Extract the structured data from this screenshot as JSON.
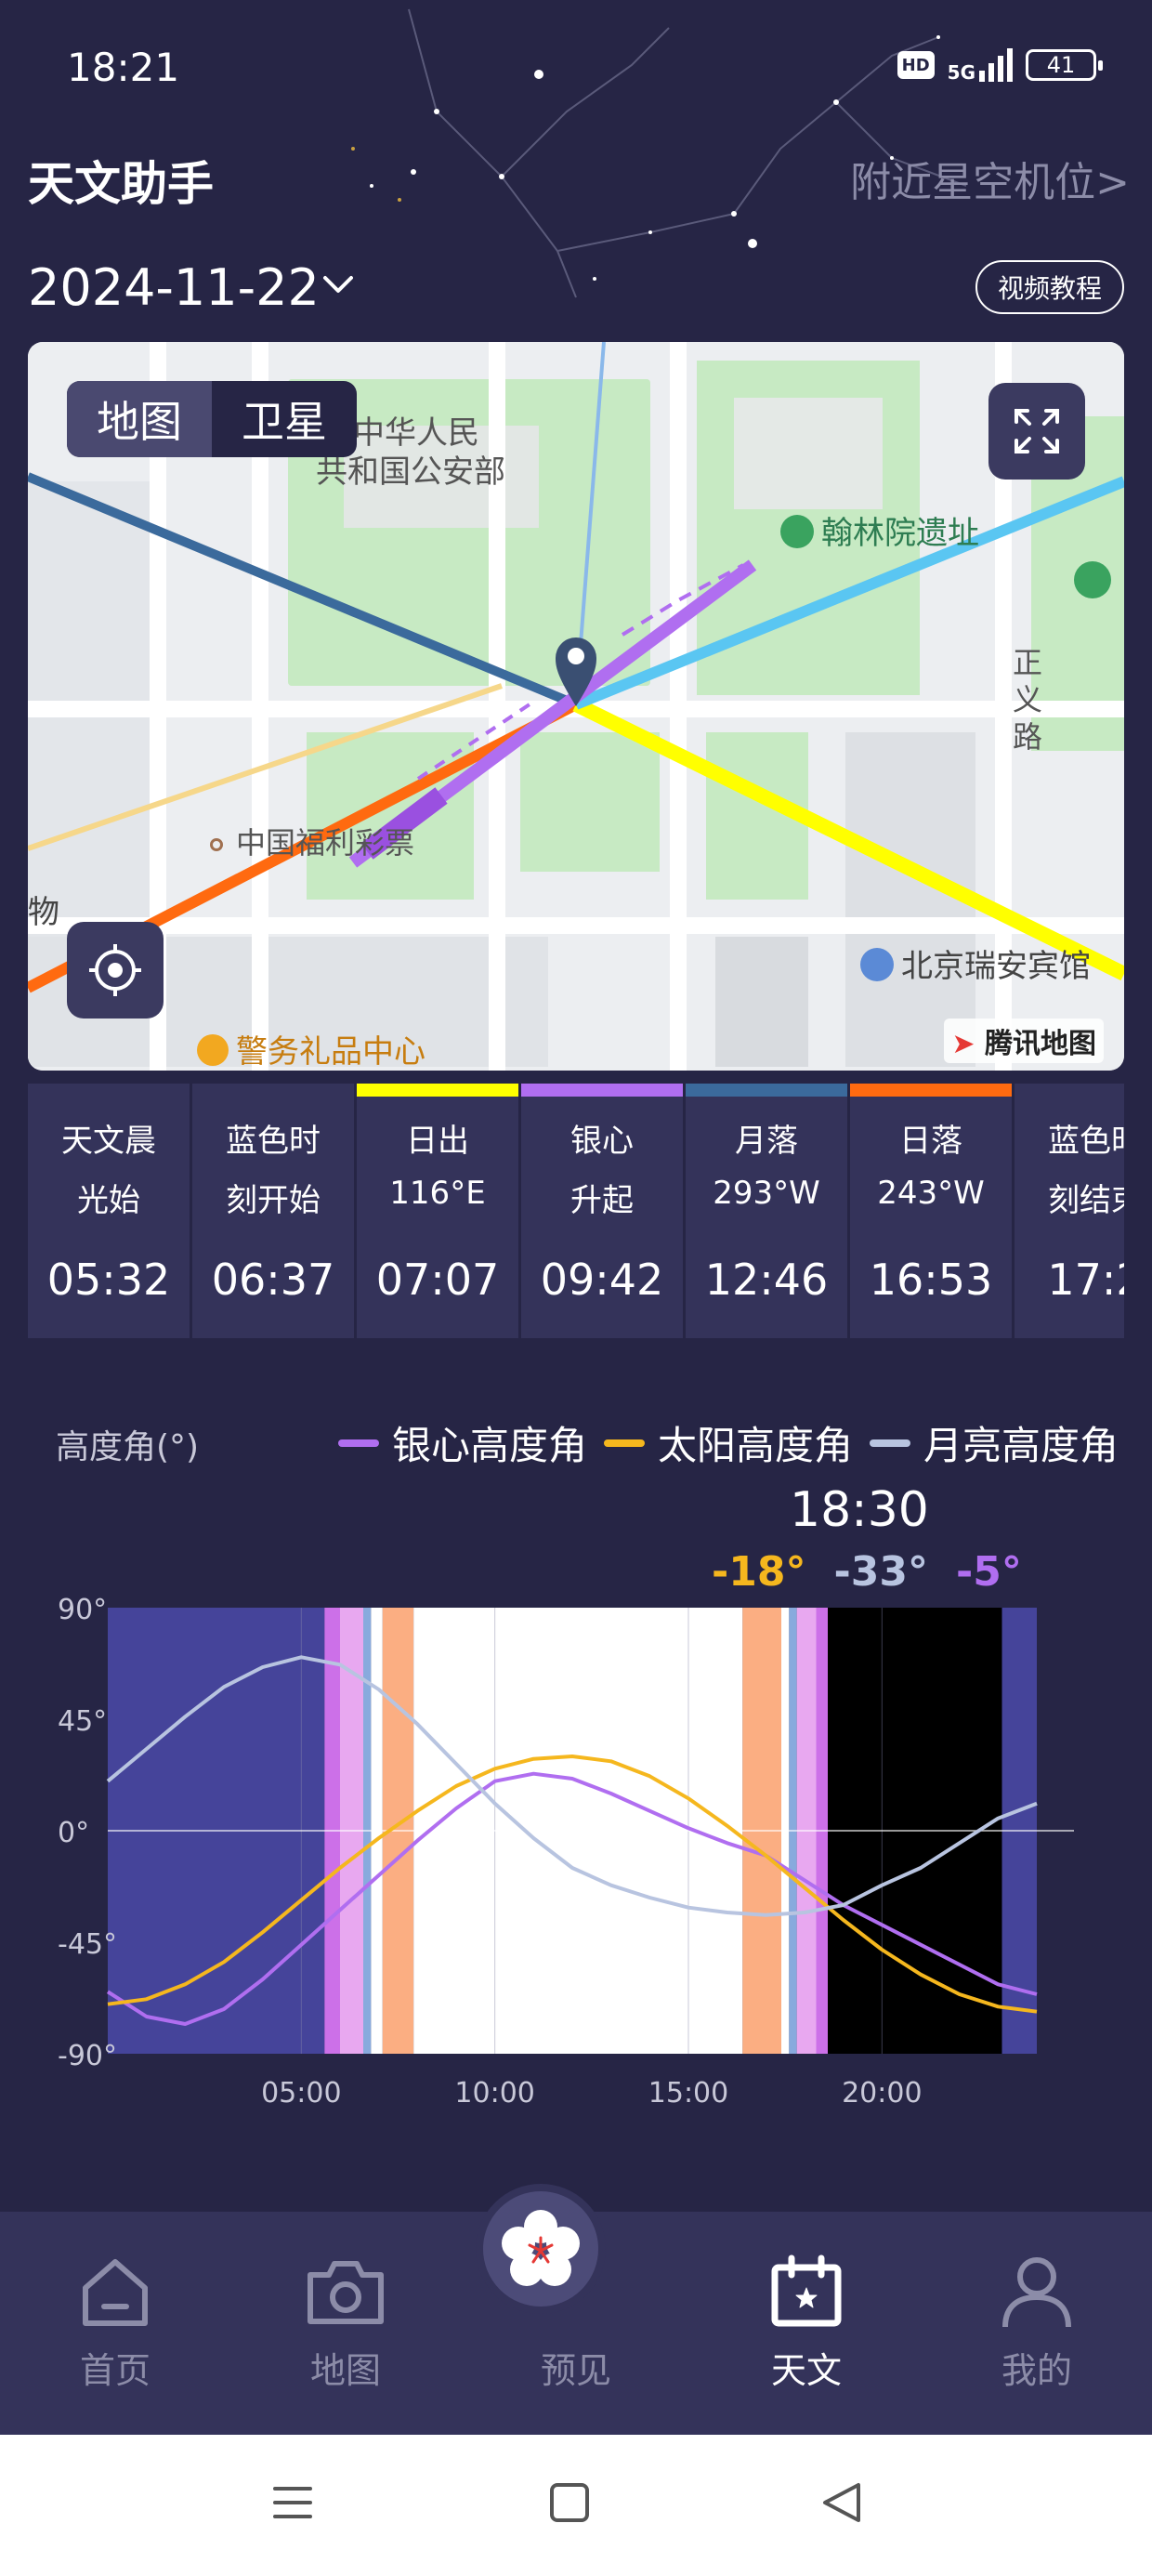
{
  "status_bar": {
    "time": "18:21",
    "hd": "HD",
    "network": "5G",
    "battery": "41"
  },
  "header": {
    "title": "天文助手",
    "nearby_link": "附近星空机位>",
    "date": "2024-11-22",
    "tutorial_button": "视频教程"
  },
  "map": {
    "toggle": {
      "map": "地图",
      "satellite": "卫星"
    },
    "labels": {
      "ministry_line1": "中华人民",
      "ministry_line2": "共和国公安部",
      "hanlin": "翰林院遗址",
      "lottery": "中国福利彩票",
      "zhengyi_1": "正",
      "zhengyi_2": "义",
      "zhengyi_3": "路",
      "hotel": "北京瑞安宾馆",
      "police_gift": "警务礼品中心",
      "edge": "物"
    },
    "brand": "腾讯地图"
  },
  "events": [
    {
      "line1": "天文晨",
      "line2": "光始",
      "time": "05:32",
      "color": ""
    },
    {
      "line1": "蓝色时",
      "line2": "刻开始",
      "time": "06:37",
      "color": ""
    },
    {
      "line1": "日出",
      "line2": "116°E",
      "time": "07:07",
      "color": "#ffff00"
    },
    {
      "line1": "银心",
      "line2": "升起",
      "time": "09:42",
      "color": "#b06ef0"
    },
    {
      "line1": "月落",
      "line2": "293°W",
      "time": "12:46",
      "color": "#3b6a9c"
    },
    {
      "line1": "日落",
      "line2": "243°W",
      "time": "16:53",
      "color": "#ff6a10"
    },
    {
      "line1": "蓝色时",
      "line2": "刻结束",
      "time": "17:2",
      "color": ""
    }
  ],
  "chart_data": {
    "type": "line",
    "ylabel": "高度角(°)",
    "ylim": [
      -90,
      90
    ],
    "yticks": [
      "90°",
      "45°",
      "0°",
      "-45°",
      "-90°"
    ],
    "xlim": [
      0,
      24
    ],
    "xticks": [
      {
        "label": "05:00",
        "value": 5
      },
      {
        "label": "10:00",
        "value": 10
      },
      {
        "label": "15:00",
        "value": 15
      },
      {
        "label": "20:00",
        "value": 20
      }
    ],
    "legend": [
      {
        "name": "银心高度角",
        "color": "#b06ef0"
      },
      {
        "name": "太阳高度角",
        "color": "#f5b71e"
      },
      {
        "name": "月亮高度角",
        "color": "#b8c4e0"
      }
    ],
    "series": [
      {
        "name": "银心高度角",
        "color": "#b06ef0",
        "x": [
          0,
          1,
          2,
          3,
          4,
          5,
          6,
          7,
          8,
          9,
          10,
          11,
          12,
          13,
          14,
          15,
          16,
          17,
          18,
          19,
          20,
          21,
          22,
          23,
          24
        ],
        "y": [
          -65,
          -75,
          -78,
          -72,
          -60,
          -46,
          -32,
          -18,
          -4,
          9,
          20,
          23,
          21,
          15,
          8,
          1,
          -5,
          -10,
          -20,
          -30,
          -38,
          -46,
          -54,
          -62,
          -66
        ]
      },
      {
        "name": "太阳高度角",
        "color": "#f5b71e",
        "x": [
          0,
          1,
          2,
          3,
          4,
          5,
          6,
          7,
          8,
          9,
          10,
          11,
          12,
          13,
          14,
          15,
          16,
          17,
          18,
          19,
          20,
          21,
          22,
          23,
          24
        ],
        "y": [
          -70,
          -68,
          -62,
          -53,
          -41,
          -28,
          -15,
          -3,
          8,
          18,
          25,
          29,
          30,
          28,
          22,
          13,
          2,
          -10,
          -23,
          -36,
          -48,
          -58,
          -66,
          -71,
          -73
        ]
      },
      {
        "name": "月亮高度角",
        "color": "#b8c4e0",
        "x": [
          0,
          1,
          2,
          3,
          4,
          5,
          6,
          7,
          8,
          9,
          10,
          11,
          12,
          13,
          14,
          15,
          16,
          17,
          18,
          19,
          20,
          21,
          22,
          23,
          24
        ],
        "y": [
          20,
          33,
          46,
          58,
          66,
          70,
          67,
          57,
          43,
          27,
          11,
          -3,
          -15,
          -22,
          -27,
          -31,
          -33,
          -34,
          -33,
          -30,
          -22,
          -15,
          -5,
          5,
          11
        ]
      }
    ],
    "bands": [
      {
        "from": 0,
        "to": 5.6,
        "color": "#45449a"
      },
      {
        "from": 5.6,
        "to": 6.0,
        "color": "#cc70e8"
      },
      {
        "from": 6.0,
        "to": 6.6,
        "color": "#e8a8f0"
      },
      {
        "from": 6.6,
        "to": 6.8,
        "color": "#88aadd"
      },
      {
        "from": 6.8,
        "to": 7.1,
        "color": "#ffffff"
      },
      {
        "from": 7.1,
        "to": 7.9,
        "color": "#fbae82"
      },
      {
        "from": 7.9,
        "to": 16.4,
        "color": "#ffffff"
      },
      {
        "from": 16.4,
        "to": 17.4,
        "color": "#fbae82"
      },
      {
        "from": 17.4,
        "to": 17.6,
        "color": "#ffffff"
      },
      {
        "from": 17.6,
        "to": 17.8,
        "color": "#88aadd"
      },
      {
        "from": 17.8,
        "to": 18.3,
        "color": "#e8a8f0"
      },
      {
        "from": 18.3,
        "to": 18.6,
        "color": "#cc70e8"
      },
      {
        "from": 18.6,
        "to": 23.1,
        "color": "#000000"
      },
      {
        "from": 23.1,
        "to": 24,
        "color": "#45449a"
      }
    ],
    "readout": {
      "time": "18:30",
      "sun": "-18°",
      "moon": "-33°",
      "galactic": "-5°",
      "sun_color": "#f5b71e",
      "moon_color": "#b8c4e0",
      "galactic_color": "#b06ef0"
    }
  },
  "nav": {
    "home": "首页",
    "map": "地图",
    "preview": "预见",
    "astronomy": "天文",
    "mine": "我的"
  }
}
